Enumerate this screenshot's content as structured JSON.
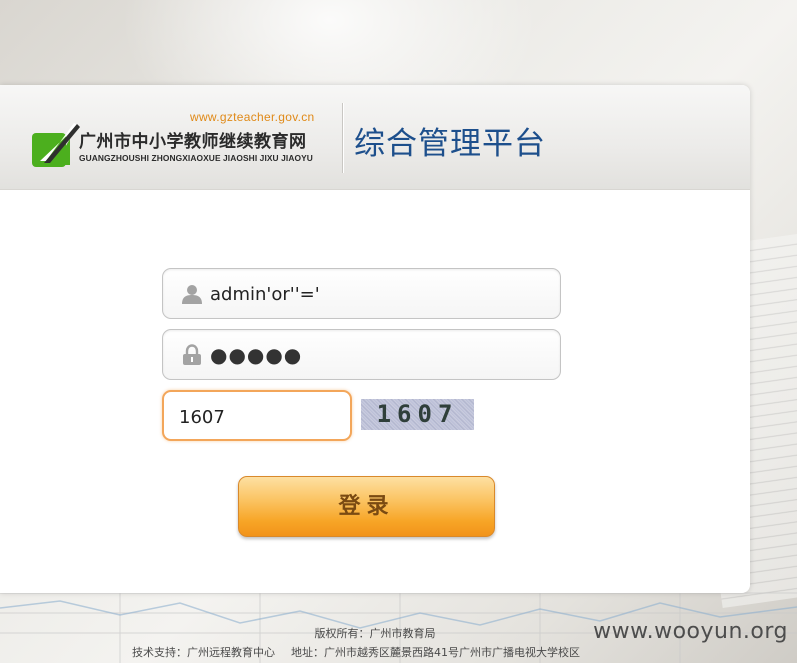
{
  "header": {
    "logo_url": "www.gzteacher.gov.cn",
    "logo_name_cn": "广州市中小学教师继续教育网",
    "logo_name_pinyin": "GUANGZHOUSHI ZHONGXIAOXUE JIAOSHI JIXU JIAOYU",
    "platform_title": "综合管理平台",
    "logo_icon": "green-chalkboard-icon",
    "accent_color": "#1d4f8c",
    "logo_color": "#4caf1e"
  },
  "form": {
    "username": {
      "icon": "user-icon",
      "value": "admin'or''='"
    },
    "password": {
      "icon": "lock-icon",
      "value": "●●●●●"
    },
    "captcha": {
      "value": "1607",
      "image_text": "1607"
    },
    "login_label": "登录",
    "button_color": "#f7a526"
  },
  "footer": {
    "copyright": "版权所有：广州市教育局",
    "support": "技术支持：广州远程教育中心",
    "address": "地址：广州市越秀区麓景西路41号广州市广播电视大学校区"
  },
  "watermark": "www.wooyun.org"
}
